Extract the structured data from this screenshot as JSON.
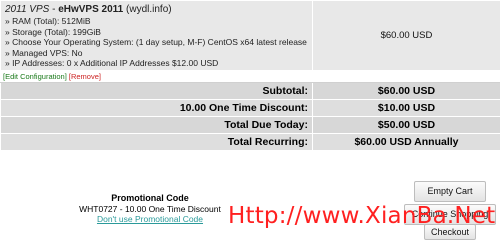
{
  "cart_item": {
    "product_group": "2011 VPS",
    "separator": " - ",
    "product_name": "eHwVPS 2011",
    "domain": " (wydl.info)",
    "details": [
      "» RAM (Total): 512MiB",
      "» Storage (Total): 199GiB",
      "» Choose Your Operating System: (1 day setup, M-F) CentOS x64 latest release",
      "» Managed VPS: No",
      "» IP Addresses: 0 x Additional IP Addresses $12.00 USD"
    ],
    "price": "$60.00 USD",
    "edit_label": "[Edit Configuration]",
    "remove_label": "[Remove]"
  },
  "totals": [
    {
      "label": "Subtotal:",
      "value": "$60.00 USD"
    },
    {
      "label": "10.00 One Time Discount:",
      "value": "$10.00 USD"
    },
    {
      "label": "Total Due Today:",
      "value": "$50.00 USD"
    },
    {
      "label": "Total Recurring:",
      "value": "$60.00 USD Annually"
    }
  ],
  "promo": {
    "title": "Promotional Code",
    "code_text": "WHT0727 - 10.00 One Time Discount",
    "remove_link": "Don't use Promotional Code"
  },
  "buttons": {
    "empty_cart": "Empty Cart",
    "continue_shopping": "Continue Shopping",
    "checkout": "Checkout"
  },
  "watermark": "Http://www.XianBa.Net",
  "colors": {
    "watermark": "#ff2020",
    "edit_link": "#1a7a1a",
    "remove_link": "#cc2222",
    "promo_link": "#2a9a9a"
  }
}
